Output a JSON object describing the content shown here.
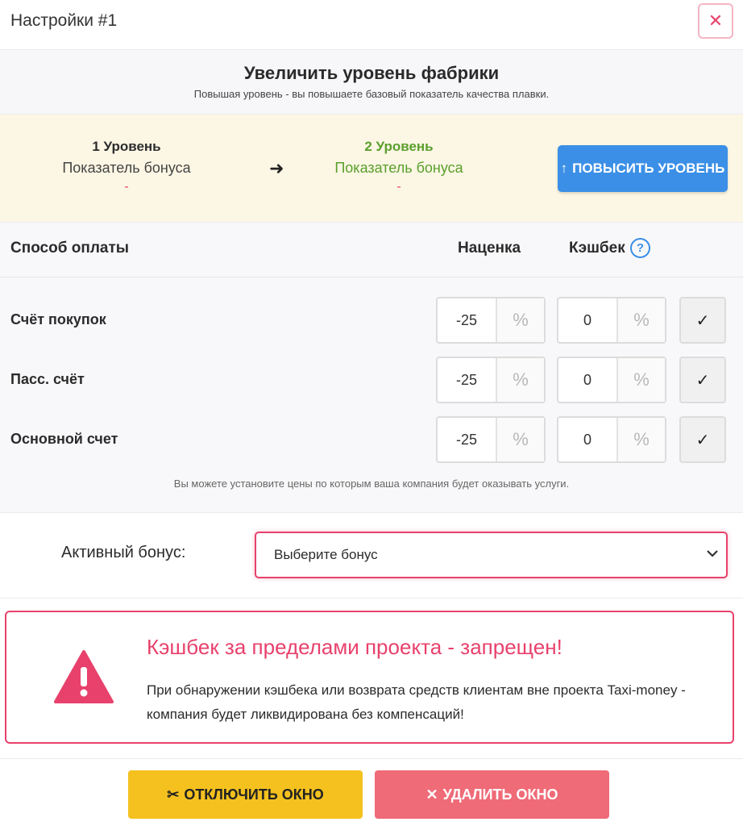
{
  "header": {
    "title": "Настройки #1",
    "close_icon": "close-icon",
    "close_glyph": "✕"
  },
  "upgrade": {
    "title": "Увеличить уровень фабрики",
    "subtitle": "Повышая уровень - вы повышаете базовый показатель качества плавки.",
    "current": {
      "level": "1 Уровень",
      "label": "Показатель бонуса",
      "value": "-"
    },
    "next": {
      "level": "2 Уровень",
      "label": "Показатель бонуса",
      "value": "-"
    },
    "arrow_icon": "arrow-right-icon",
    "arrow_glyph": "➜",
    "button_icon": "arrow-up-icon",
    "button_icon_glyph": "↑",
    "button_label": "ПОВЫСИТЬ УРОВЕНЬ",
    "colors": {
      "accent": "#3b8fe6",
      "next_level": "#5aa02c",
      "value": "#e8416c",
      "panel_bg": "#fcf6e4"
    }
  },
  "payment": {
    "headers": {
      "method": "Способ оплаты",
      "markup": "Наценка",
      "cashback": "Кэшбек"
    },
    "help_icon": "help-icon",
    "help_glyph": "?",
    "rows": [
      {
        "label": "Счёт покупок",
        "markup": "-25",
        "markup_unit": "%",
        "cashback": "0",
        "cashback_unit": "%",
        "check_glyph": "✓"
      },
      {
        "label": "Пасс. счёт",
        "markup": "-25",
        "markup_unit": "%",
        "cashback": "0",
        "cashback_unit": "%",
        "check_glyph": "✓"
      },
      {
        "label": "Основной счет",
        "markup": "-25",
        "markup_unit": "%",
        "cashback": "0",
        "cashback_unit": "%",
        "check_glyph": "✓"
      }
    ],
    "note": "Вы можете установите цены по которым ваша компания будет оказывать услуги."
  },
  "bonus": {
    "label": "Активный бонус:",
    "selected": "Выберите бонус",
    "chevron_glyph": "⌄",
    "chevron_icon": "chevron-down-icon"
  },
  "warning": {
    "icon": "warning-triangle-icon",
    "title": "Кэшбек за пределами проекта - запрещен!",
    "text": "При обнаружении кэшбека или возврата средств клиентам вне проекта Taxi-money - компания будет ликвидирована без компенсаций!",
    "color": "#e8416c"
  },
  "footer": {
    "disable_icon": "tools-icon",
    "disable_glyph": "✂",
    "disable_label": "ОТКЛЮЧИТЬ ОКНО",
    "delete_icon": "close-icon",
    "delete_glyph": "✕",
    "delete_label": "УДАЛИТЬ ОКНО",
    "colors": {
      "disable": "#f4c11f",
      "delete": "#ef6b77"
    }
  }
}
